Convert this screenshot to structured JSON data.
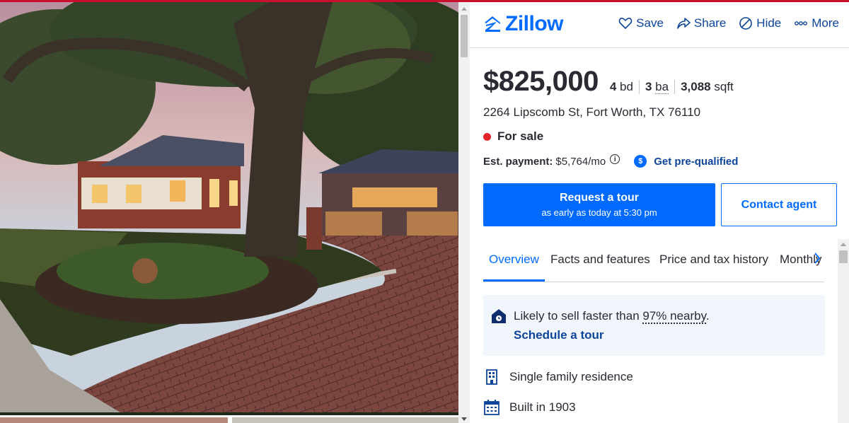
{
  "header": {
    "brand": "Zillow",
    "actions": [
      {
        "label": "Save",
        "icon": "heart-icon"
      },
      {
        "label": "Share",
        "icon": "share-icon"
      },
      {
        "label": "Hide",
        "icon": "hide-icon"
      },
      {
        "label": "More",
        "icon": "more-icon"
      }
    ]
  },
  "listing": {
    "price": "$825,000",
    "beds_value": "4",
    "beds_label": "bd",
    "baths_value": "3",
    "baths_label": "ba",
    "sqft_value": "3,088",
    "sqft_label": "sqft",
    "address": "2264 Lipscomb St, Fort Worth, TX 76110",
    "status": "For sale",
    "payment_label": "Est. payment:",
    "payment_value": "$5,764/mo",
    "prequal_label": "Get pre-qualified"
  },
  "buttons": {
    "tour_title": "Request a tour",
    "tour_subtitle": "as early as today at 5:30 pm",
    "contact": "Contact agent"
  },
  "tabs": [
    "Overview",
    "Facts and features",
    "Price and tax history",
    "Monthly payment"
  ],
  "callout": {
    "prefix": "Likely to sell faster than ",
    "highlight": "97% nearby",
    "suffix": ".",
    "link": "Schedule a tour"
  },
  "facts": [
    {
      "icon": "building-icon",
      "text": "Single family residence"
    },
    {
      "icon": "calendar-icon",
      "text": "Built in 1903"
    }
  ],
  "colors": {
    "brand": "#006aff",
    "link": "#0d4599",
    "status_dot": "#e3242b",
    "callout_bg": "#f1f6fc"
  }
}
